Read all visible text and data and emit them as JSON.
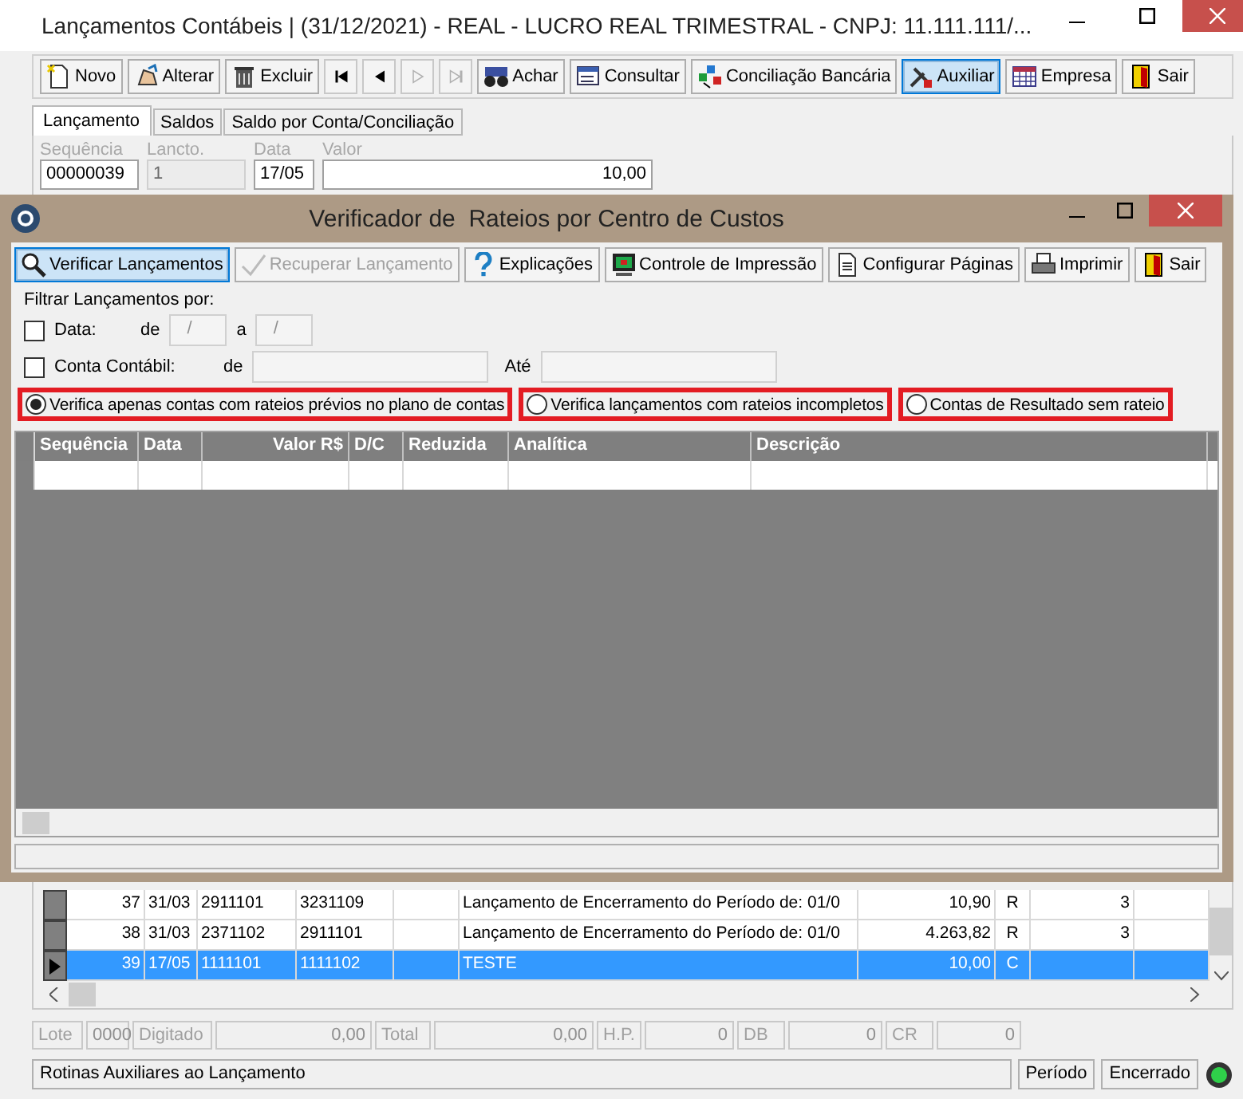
{
  "main_window": {
    "title": "Lançamentos Contábeis | (31/12/2021) - REAL - LUCRO REAL TRIMESTRAL  - CNPJ: 11.111.111/...",
    "toolbar": [
      {
        "kind": "button",
        "label": "Novo",
        "disabled": false,
        "focused": false
      },
      {
        "kind": "button",
        "label": "Alterar",
        "disabled": false,
        "focused": false
      },
      {
        "kind": "button",
        "label": "Excluir",
        "disabled": false,
        "focused": false
      },
      {
        "kind": "nav",
        "disabled": false,
        "focused": false
      },
      {
        "kind": "nav",
        "disabled": false,
        "focused": false
      },
      {
        "kind": "nav",
        "disabled": true,
        "focused": false
      },
      {
        "kind": "nav",
        "disabled": true,
        "focused": false
      },
      {
        "kind": "button",
        "label": "Achar",
        "disabled": false,
        "focused": false
      },
      {
        "kind": "button",
        "label": "Consultar",
        "disabled": false,
        "focused": false
      },
      {
        "kind": "button",
        "label": "Conciliação Bancária",
        "disabled": false,
        "focused": false
      },
      {
        "kind": "button",
        "label": "Auxiliar",
        "disabled": false,
        "focused": true
      },
      {
        "kind": "button",
        "label": "Empresa",
        "disabled": false,
        "focused": false
      },
      {
        "kind": "button",
        "label": "Sair",
        "disabled": false,
        "focused": false
      }
    ],
    "tabs": [
      {
        "label": "Lançamento",
        "selected": true
      },
      {
        "label": "Saldos",
        "selected": false
      },
      {
        "label": "Saldo por Conta/Conciliação",
        "selected": false
      }
    ],
    "fields": [
      {
        "label": "Sequência",
        "value": "00000039",
        "disabled": false
      },
      {
        "label": "Lancto.",
        "value": "1",
        "disabled": true
      },
      {
        "label": "Data",
        "value": "17/05",
        "disabled": false
      },
      {
        "label": "Valor",
        "value": "10,00",
        "disabled": false
      }
    ],
    "grid_rows": [
      {
        "sequence": "37",
        "date": "31/03",
        "debit": "2911101",
        "credit": "3231109",
        "description": "Lançamento de Encerramento do Período de: 01/0",
        "amount": "10,90",
        "dc": "R",
        "column_9": "3",
        "selected": false
      },
      {
        "sequence": "38",
        "date": "31/03",
        "debit": "2371102",
        "credit": "2911101",
        "description": "Lançamento de Encerramento do Período de: 01/0",
        "amount": "4.263,82",
        "dc": "R",
        "column_9": "3",
        "selected": false
      },
      {
        "sequence": "39",
        "date": "17/05",
        "debit": "1111101",
        "credit": "1111102",
        "description": "TESTE",
        "amount": "10,00",
        "dc": "C",
        "selected": true
      }
    ],
    "totals": [
      {
        "kind": "label",
        "text": "Lote"
      },
      {
        "kind": "value",
        "text": "0000"
      },
      {
        "kind": "label",
        "text": "Digitado"
      },
      {
        "kind": "value",
        "text": "0,00"
      },
      {
        "kind": "label",
        "text": "Total"
      },
      {
        "kind": "value",
        "text": "0,00"
      },
      {
        "kind": "label",
        "text": "H.P."
      },
      {
        "kind": "value",
        "text": "0"
      },
      {
        "kind": "label",
        "text": "DB"
      },
      {
        "kind": "value",
        "text": "0"
      },
      {
        "kind": "label",
        "text": "CR"
      },
      {
        "kind": "value",
        "text": "0"
      }
    ],
    "status_bar": {
      "message": "Rotinas Auxiliares ao Lançamento",
      "panels": [
        "Período",
        "Encerrado"
      ]
    }
  },
  "dialog": {
    "title": "Verificador de  Rateios por Centro de Custos",
    "toolbar": [
      {
        "label": "Verificar Lançamentos",
        "disabled": false,
        "focused": true
      },
      {
        "label": "Recuperar Lançamento",
        "disabled": true,
        "focused": false
      },
      {
        "label": "Explicações",
        "disabled": false,
        "focused": false
      },
      {
        "label": "Controle de Impressão",
        "disabled": false,
        "focused": false
      },
      {
        "label": "Configurar Páginas",
        "disabled": false,
        "focused": false
      },
      {
        "label": "Imprimir",
        "disabled": false,
        "focused": false
      },
      {
        "label": "Sair",
        "disabled": false,
        "focused": false
      }
    ],
    "filter": {
      "heading": "Filtrar Lançamentos por:",
      "date": {
        "label": "Data:",
        "checked": false,
        "from_label": "de",
        "from_value": "/",
        "to_label": "a",
        "to_value": "/"
      },
      "account": {
        "label": "Conta Contábil:",
        "checked": false,
        "from_label": "de",
        "to_label": "Até"
      }
    },
    "options": [
      {
        "label": "Verifica apenas contas com rateios prévios no plano de contas",
        "selected": true
      },
      {
        "label": "Verifica lançamentos com rateios incompletos",
        "selected": false
      },
      {
        "label": "Contas de Resultado sem rateio",
        "selected": false
      }
    ],
    "columns": [
      "Sequência",
      "Data",
      "Valor R$",
      "D/C",
      "Reduzida",
      "Analítica",
      "Descrição"
    ]
  }
}
